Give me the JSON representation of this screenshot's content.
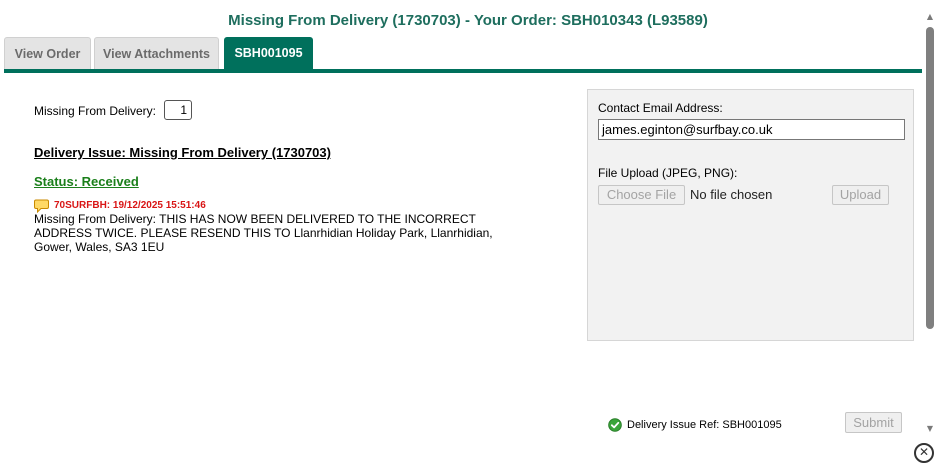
{
  "modal": {
    "title": "Missing From Delivery (1730703) - Your Order: SBH010343 (L93589)"
  },
  "tabs": [
    {
      "label": "View Order",
      "active": false
    },
    {
      "label": "View Attachments",
      "active": false
    },
    {
      "label": "SBH001095",
      "active": true
    }
  ],
  "details": {
    "quantity_label": "Missing From Delivery:",
    "quantity_value": "1",
    "issue_heading": "Delivery Issue: Missing From Delivery (1730703)",
    "status": "Status: Received",
    "note": {
      "icon": "speech-bubble-icon",
      "meta": "70SURFBH: 19/12/2025 15:51:46",
      "text": "Missing From Delivery: THIS HAS NOW BEEN DELIVERED TO THE INCORRECT ADDRESS TWICE. PLEASE RESEND THIS TO Llanrhidian Holiday Park, Llanrhidian, Gower, Wales, SA3 1EU"
    }
  },
  "contact": {
    "email_label": "Contact Email Address:",
    "email_value": "james.eginton@surfbay.co.uk",
    "upload_label": "File Upload (JPEG, PNG):",
    "choose_file_label": "Choose File",
    "no_file_text": "No file chosen",
    "upload_button": "Upload"
  },
  "footer": {
    "ref_icon": "check-circle-icon",
    "ref_text": "Delivery Issue Ref: SBH001095",
    "submit_button": "Submit",
    "close_icon": "close-icon"
  },
  "colors": {
    "accent": "#00705c",
    "title": "#1e6e5e",
    "status": "#1a7f1a",
    "note_meta": "#d91515"
  }
}
